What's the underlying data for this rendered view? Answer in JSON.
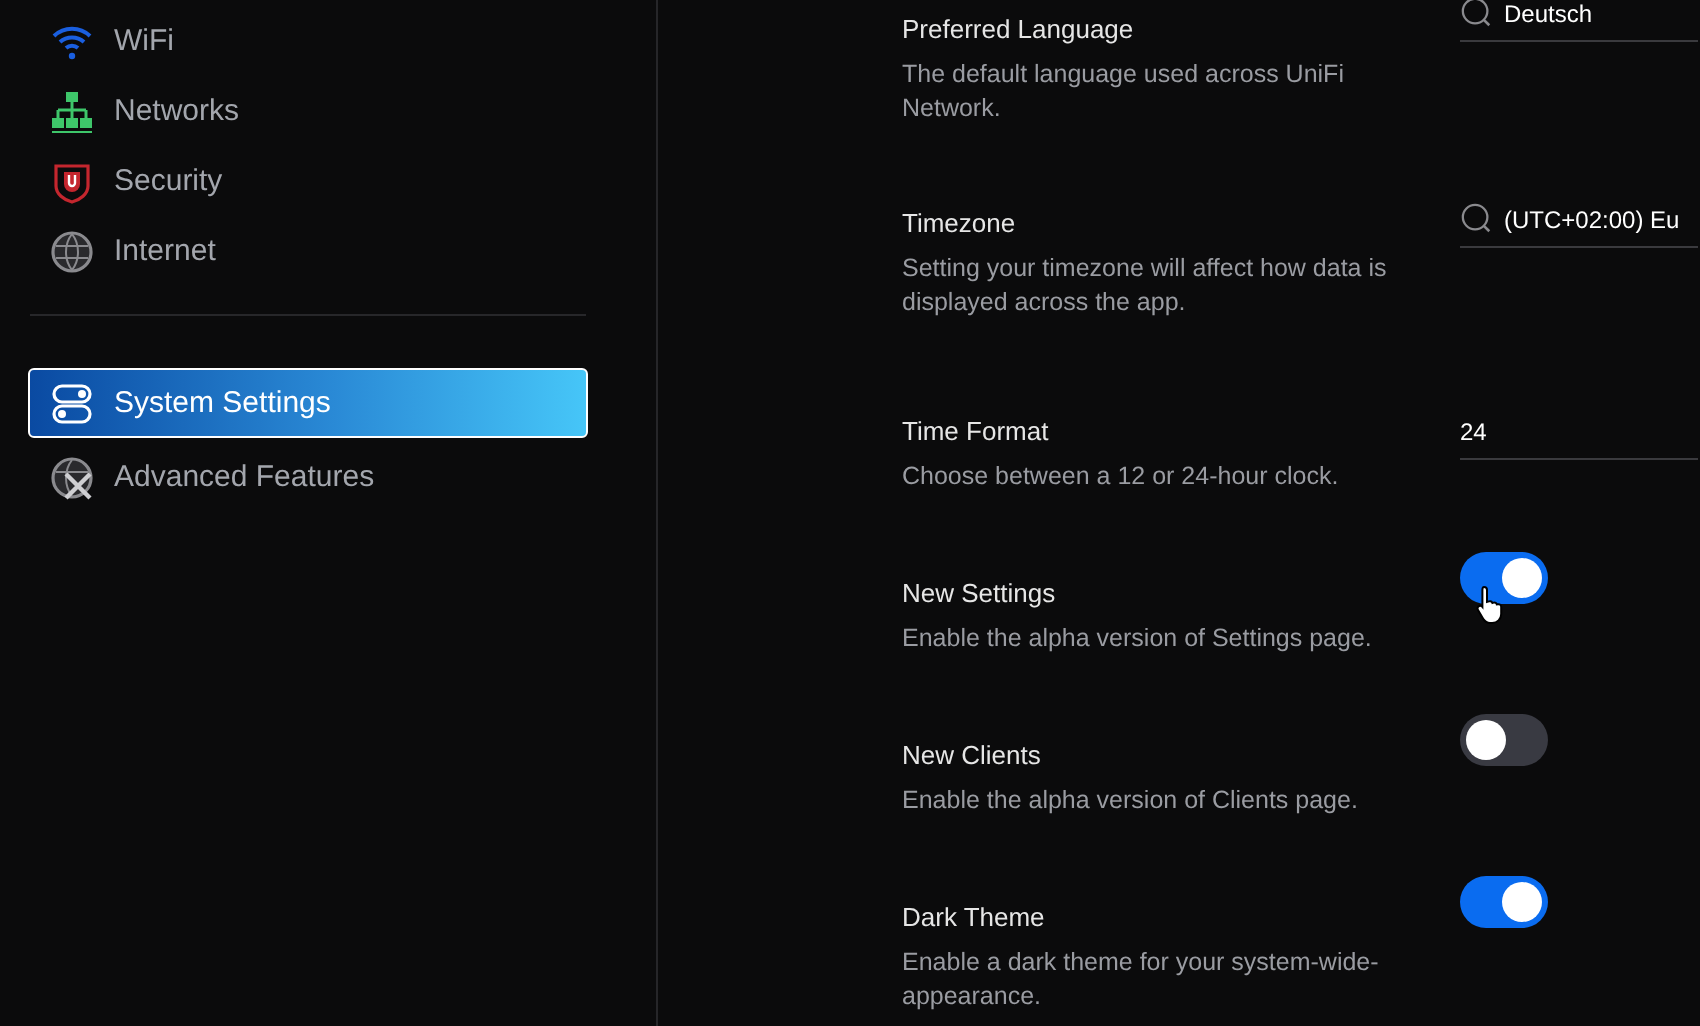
{
  "sidebar": {
    "items": [
      {
        "label": "WiFi",
        "selected": false
      },
      {
        "label": "Networks",
        "selected": false
      },
      {
        "label": "Security",
        "selected": false
      },
      {
        "label": "Internet",
        "selected": false
      }
    ],
    "lower_items": [
      {
        "label": "System Settings",
        "selected": true
      },
      {
        "label": "Advanced Features",
        "selected": false
      }
    ]
  },
  "settings": [
    {
      "kind": "search",
      "title": "Preferred Language",
      "description": "The default language used across UniFi Network.",
      "value": "Deutsch"
    },
    {
      "kind": "search",
      "title": "Timezone",
      "description": "Setting your timezone will affect how data is displayed across the app.",
      "value": "(UTC+02:00) Eu"
    },
    {
      "kind": "value",
      "title": "Time Format",
      "description": "Choose between a 12 or 24-hour clock.",
      "value": "24"
    },
    {
      "kind": "toggle",
      "title": "New Settings",
      "description": "Enable the alpha version of Settings page.",
      "on": true
    },
    {
      "kind": "toggle",
      "title": "New Clients",
      "description": "Enable the alpha version of Clients page.",
      "on": false
    },
    {
      "kind": "toggle",
      "title": "Dark Theme",
      "description": "Enable a dark theme for your system-wide-appearance.",
      "on": true
    }
  ]
}
